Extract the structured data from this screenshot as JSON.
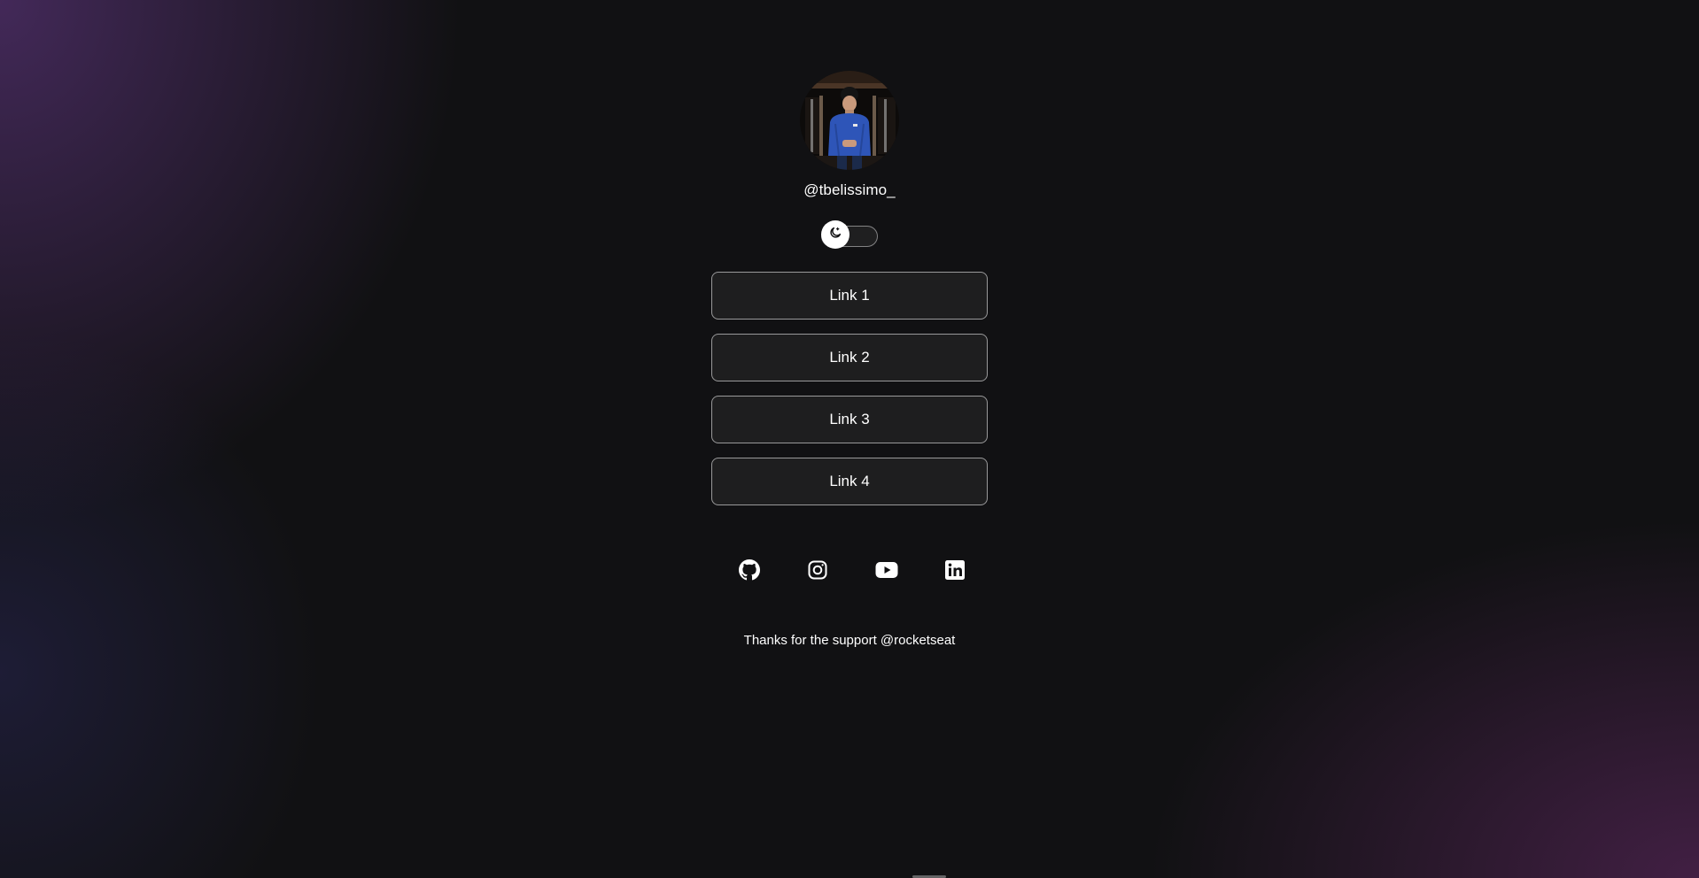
{
  "profile": {
    "handle": "@tbelissimo_"
  },
  "theme_switch": {
    "state": "dark",
    "icon": "moon-icon"
  },
  "links": [
    {
      "label": "Link 1"
    },
    {
      "label": "Link 2"
    },
    {
      "label": "Link 3"
    },
    {
      "label": "Link 4"
    }
  ],
  "socials": [
    {
      "icon": "github-icon"
    },
    {
      "icon": "instagram-icon"
    },
    {
      "icon": "youtube-icon"
    },
    {
      "icon": "linkedin-icon"
    }
  ],
  "footer": {
    "text": "Thanks for the support @rocketseat"
  },
  "colors": {
    "text": "#ffffff",
    "background": "#111113",
    "accent_purple": "#4e2e68",
    "button_border": "#8c8c8f"
  }
}
